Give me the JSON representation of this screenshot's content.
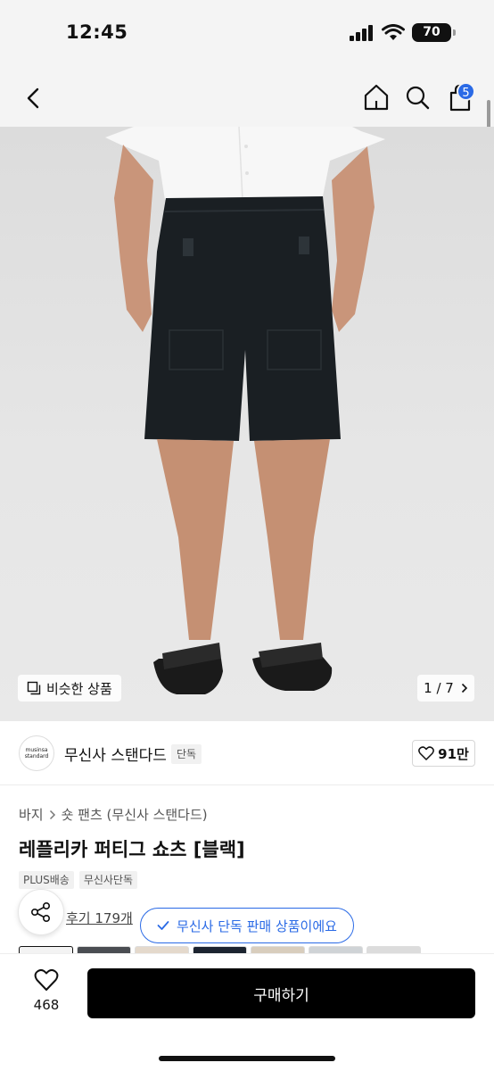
{
  "status": {
    "time": "12:45",
    "battery": "70"
  },
  "nav": {
    "cart_count": "5",
    "icons": [
      "back-icon",
      "home-icon",
      "search-icon",
      "bag-icon"
    ]
  },
  "gallery": {
    "similar_label": "비슷한 상품",
    "counter": "1 / 7"
  },
  "brand": {
    "logo_line1": "musinsa",
    "logo_line2": "standard",
    "name": "무신사 스탠다드",
    "tag": "단독",
    "likes": "91만"
  },
  "product": {
    "breadcrumb": [
      "바지",
      "숏 팬츠 (무신사 스탠다드)"
    ],
    "title": "레플리카 퍼티그 쇼츠 [블랙]",
    "tags": [
      "PLUS배송",
      "무신사단독"
    ],
    "reviews": "후기 179개",
    "exclusive_label": "무신사 단독 판매 상품이에요"
  },
  "bottom": {
    "wish_count": "468",
    "buy_label": "구매하기"
  },
  "colors": {
    "accent": "#2a6ae6",
    "buy": "#000000"
  }
}
